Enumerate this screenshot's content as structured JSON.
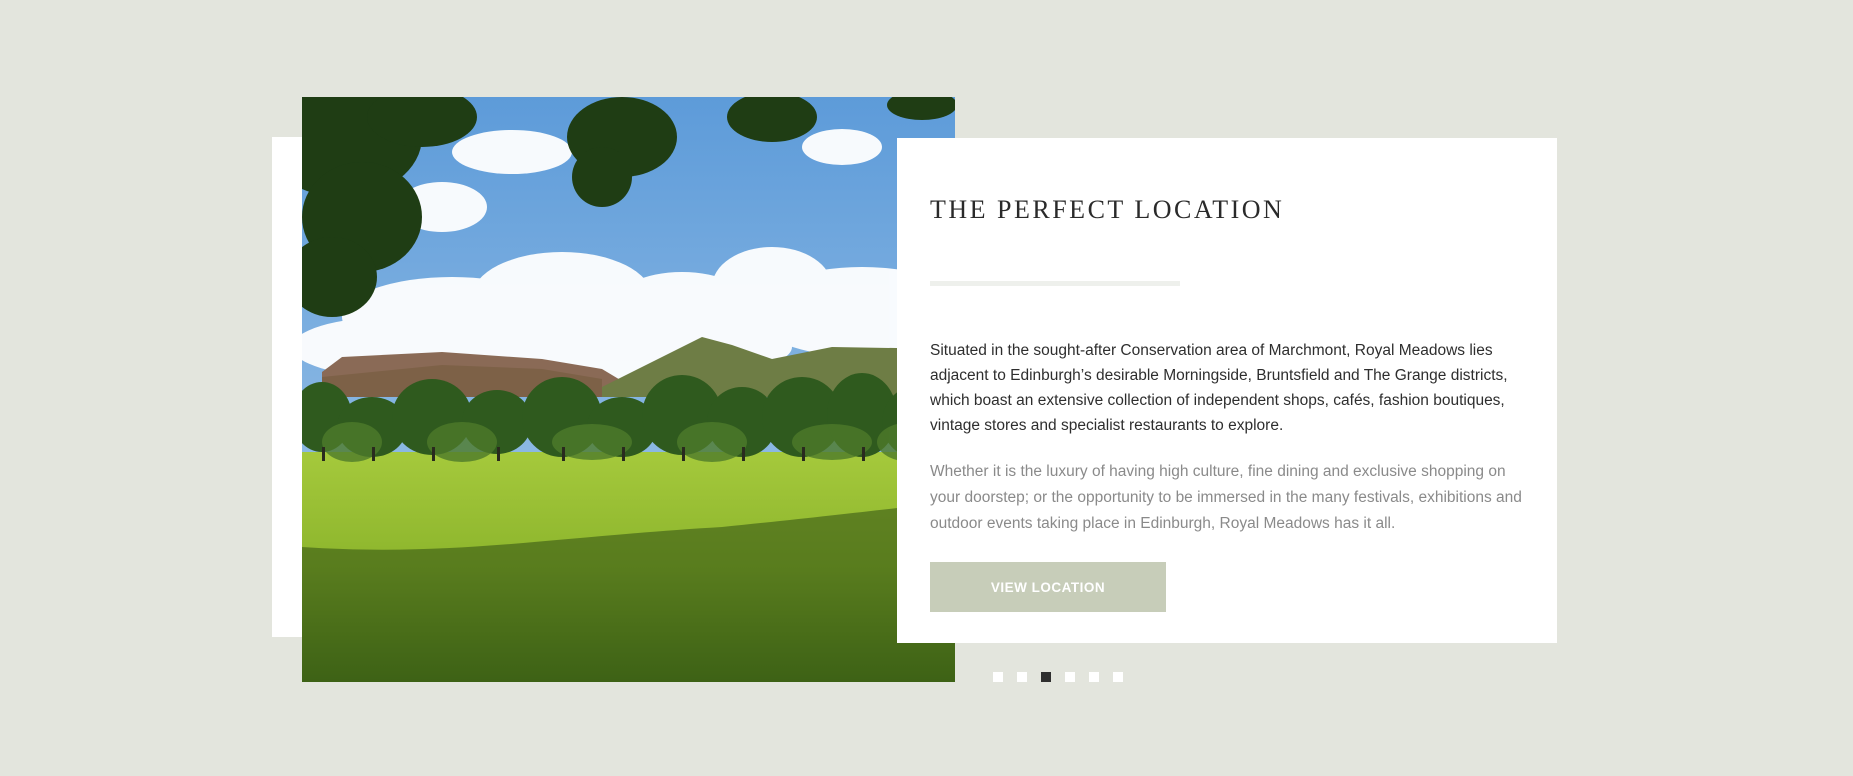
{
  "section": {
    "title": "THE PERFECT LOCATION",
    "lead": "Situated in the sought-after Conservation area of Marchmont, Royal Meadows lies adjacent to Edinburgh’s desirable Morningside, Bruntsfield and The Grange districts, which boast an extensive collection of independent shops, cafés, fashion boutiques, vintage stores and specialist restaurants to explore.",
    "body": "Whether it is the luxury of having high culture, fine dining and exclusive shopping on your doorstep; or the opportunity to be immersed in the many festivals, exhibitions and outdoor events taking place in Edinburgh, Royal Meadows has it all.",
    "cta_label": "VIEW LOCATION"
  },
  "carousel": {
    "slide_count": 6,
    "active_index": 2
  },
  "colors": {
    "page_background": "#e3e5dd",
    "card_background": "#ffffff",
    "button_background": "#c7cdb9",
    "dot_active": "#2f2f2f",
    "dot_inactive": "#ffffff"
  }
}
